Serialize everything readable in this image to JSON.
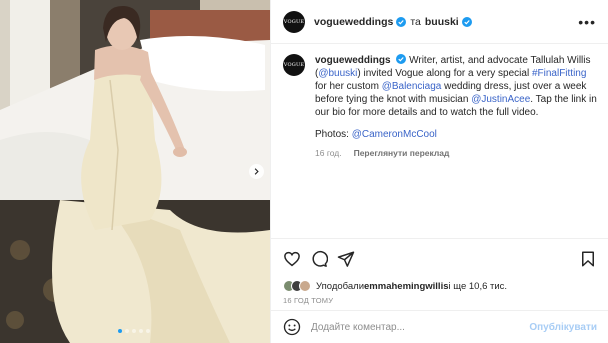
{
  "post": {
    "author": "voguewedding",
    "author_suffix": "s",
    "coauthor_joiner": "та",
    "coauthor": "buuski",
    "avatar_text": "VOGUE"
  },
  "caption": {
    "author": "voguewedding",
    "author_suffix": "s",
    "text_1": " Writer, artist, and advocate Tallulah Willis (",
    "mention_1": "@buuski",
    "text_2": ") invited Vogue along for a very special ",
    "hashtag": "#FinalFitting",
    "text_3": " for her custom ",
    "mention_2": "@Balenciaga",
    "text_4": " wedding dress, just over a week before tying the knot with musician ",
    "mention_3": "@JustinAcee",
    "text_5": ". Tap the link in our bio for more details and to watch the full video.",
    "photos_label": "Photos: ",
    "photos_mention": "@CameronMcCool",
    "age": "16 год.",
    "translate": "Переглянути переклад"
  },
  "likes": {
    "prefix": "Уподобали ",
    "user": "emmahemingwillis",
    "suffix": " і ще 10,6 тис."
  },
  "timestamp": "16 ГОД ТОМУ",
  "comment": {
    "placeholder": "Додайте коментар...",
    "publish": "Опублікувати"
  },
  "colors": {
    "verified": "#1d9bf0",
    "link": "#3a64c8",
    "publish_disabled": "#a8cdf5"
  },
  "carousel": {
    "pages": 5,
    "active": 1
  }
}
